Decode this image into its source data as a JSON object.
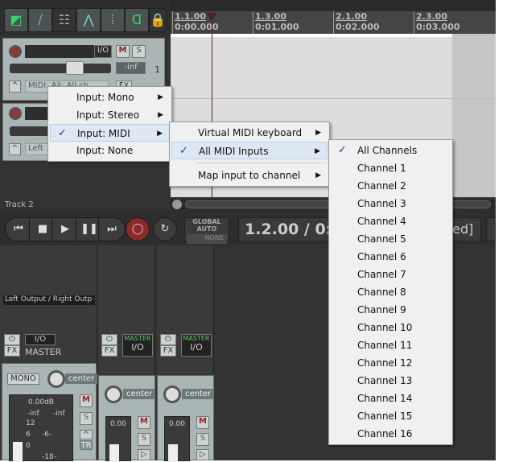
{
  "toolbar": {
    "icons": [
      "item-edit-icon",
      "ripple-icon",
      "grid-select-icon",
      "envelope-icon",
      "snap-grid-icon",
      "loop-icon",
      "lock-icon"
    ]
  },
  "ruler": {
    "marks": [
      {
        "bar": "1.1.00",
        "time": "0:00.000"
      },
      {
        "bar": "1.3.00",
        "time": "0:01.000"
      },
      {
        "bar": "2.1.00",
        "time": "0:02.000"
      },
      {
        "bar": "2.3.00",
        "time": "0:03.000"
      }
    ]
  },
  "tracks": [
    {
      "io": "I/O",
      "mute": "M",
      "solo": "S",
      "volume": "-inf",
      "number": "1",
      "input": "MIDI: All: All ch",
      "fx": "FX"
    },
    {
      "input": "Left",
      "name": "Track 2"
    }
  ],
  "transport": {
    "global_auto": "GLOBAL AUTO",
    "auto_mode": "NONE",
    "position": "1.2.00 / 0:0",
    "status": "ped]"
  },
  "mixer": {
    "master": {
      "routing": "Left Output / Right Outp",
      "io": "I/O",
      "fx": "FX",
      "name": "MASTER",
      "mono": "MONO",
      "pan": "center",
      "db": "0.00dB",
      "peak_l": "-inf",
      "peak_r": "-inf",
      "scale": [
        "12",
        "6",
        "0",
        "-6-",
        "-18-"
      ],
      "mute": "M",
      "solo": "S",
      "tr": "TR"
    },
    "strips": [
      {
        "send": "MASTER",
        "io": "I/O",
        "fx": "FX",
        "pan": "center",
        "vol": "0.00",
        "mute": "M",
        "solo": "S"
      },
      {
        "send": "MASTER",
        "io": "I/O",
        "fx": "FX",
        "pan": "center",
        "vol": "0.00",
        "mute": "M",
        "solo": "S"
      }
    ]
  },
  "menu_input": [
    {
      "label": "Input: Mono",
      "checked": false
    },
    {
      "label": "Input: Stereo",
      "checked": false
    },
    {
      "label": "Input: MIDI",
      "checked": true
    },
    {
      "label": "Input: None",
      "checked": false
    }
  ],
  "menu_midi": [
    {
      "label": "Virtual MIDI keyboard"
    },
    {
      "label": "All MIDI Inputs",
      "checked": true
    },
    {
      "label": "Map input to channel"
    }
  ],
  "menu_channels": [
    "All Channels",
    "Channel 1",
    "Channel 2",
    "Channel 3",
    "Channel 4",
    "Channel 5",
    "Channel 6",
    "Channel 7",
    "Channel 8",
    "Channel 9",
    "Channel 10",
    "Channel 11",
    "Channel 12",
    "Channel 13",
    "Channel 14",
    "Channel 15",
    "Channel 16"
  ],
  "check": "✓"
}
